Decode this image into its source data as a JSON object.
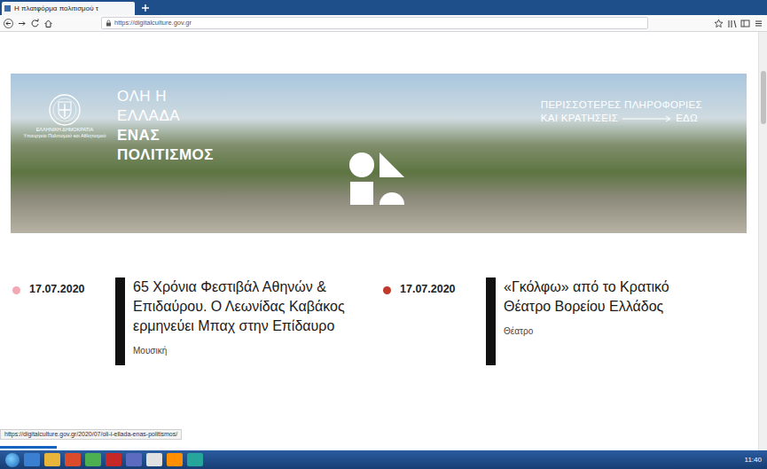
{
  "browser": {
    "tab_title": "Η πλατφόρμα πολιτισμού τ",
    "url": "https://digitalculture.gov.gr"
  },
  "banner": {
    "emblem_lines": [
      "ΕΛΛΗΝΙΚΗ ΔΗΜΟΚΡΑΤΙΑ",
      "Υπουργείο Πολιτισμού και Αθλητισμού"
    ],
    "title_lines": [
      {
        "text": "ΟΛΗ Η",
        "bold": false
      },
      {
        "text": "ΕΛΛΑΔΑ",
        "bold": false
      },
      {
        "text": "ΕΝΑΣ",
        "bold": true
      },
      {
        "text": "ΠΟΛΙΤΙΣΜΟΣ",
        "bold": true
      }
    ],
    "cta_lines": [
      "ΠΕΡΙΣΣΟΤΕΡΕΣ ΠΛΗΡΟΦΟΡΙΕΣ",
      "ΚΑΙ ΚΡΑΤΗΣΕΙΣ"
    ],
    "cta_link": "ΕΔΩ"
  },
  "articles": [
    {
      "date": "17.07.2020",
      "title": "65 Χρόνια Φεστιβάλ Αθηνών & Επιδαύρου. Ο Λεωνίδας Καβάκος ερμηνεύει Μπαχ στην Επίδαυρο",
      "category": "Μουσική",
      "color": "#f2a9b4"
    },
    {
      "date": "17.07.2020",
      "title": "«Γκόλφω» από το Κρατικό Θέατρο Βορείου Ελλάδος",
      "category": "Θέατρο",
      "color": "#c0392b"
    }
  ],
  "status_url": "https://digitalculture.gov.gr/2020/07/oli-i-ellada-enas-politismos/",
  "loading": {
    "level": 0.16
  },
  "taskbar": {
    "clock": "11:40"
  }
}
